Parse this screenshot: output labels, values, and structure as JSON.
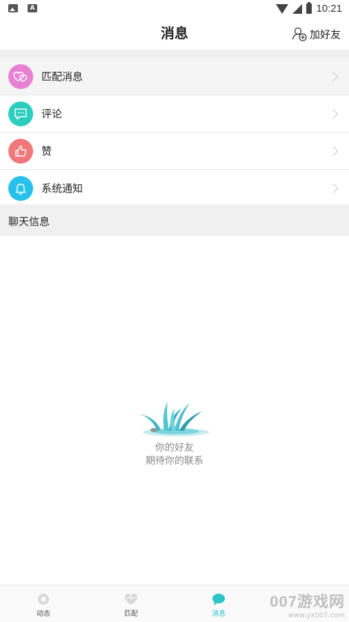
{
  "status_bar": {
    "time": "10:21",
    "left_icons": [
      "image-icon",
      "a-icon"
    ]
  },
  "header": {
    "title": "消息",
    "add_friend_label": "加好友"
  },
  "notifications": [
    {
      "label": "匹配消息",
      "icon": "heart-icon",
      "color": "#e681d4"
    },
    {
      "label": "评论",
      "icon": "comment-icon",
      "color": "#2ccdbd"
    },
    {
      "label": "赞",
      "icon": "thumb-icon",
      "color": "#f0787a"
    },
    {
      "label": "系统通知",
      "icon": "bell-icon",
      "color": "#27c1ec"
    }
  ],
  "section": {
    "label": "聊天信息"
  },
  "empty_state": {
    "line1": "你的好友",
    "line2": "期待你的联系"
  },
  "bottom_nav": {
    "tabs": [
      {
        "label": "动态",
        "icon": "moments-icon",
        "active": false
      },
      {
        "label": "匹配",
        "icon": "heart-icon",
        "active": false
      },
      {
        "label": "消息",
        "icon": "chat-icon",
        "active": true
      }
    ]
  },
  "watermark": {
    "brand": "007游戏网",
    "url": "www.yx007.com"
  },
  "colors": {
    "accent": "#2cc3c9",
    "section_bg": "#f0f0f0"
  }
}
